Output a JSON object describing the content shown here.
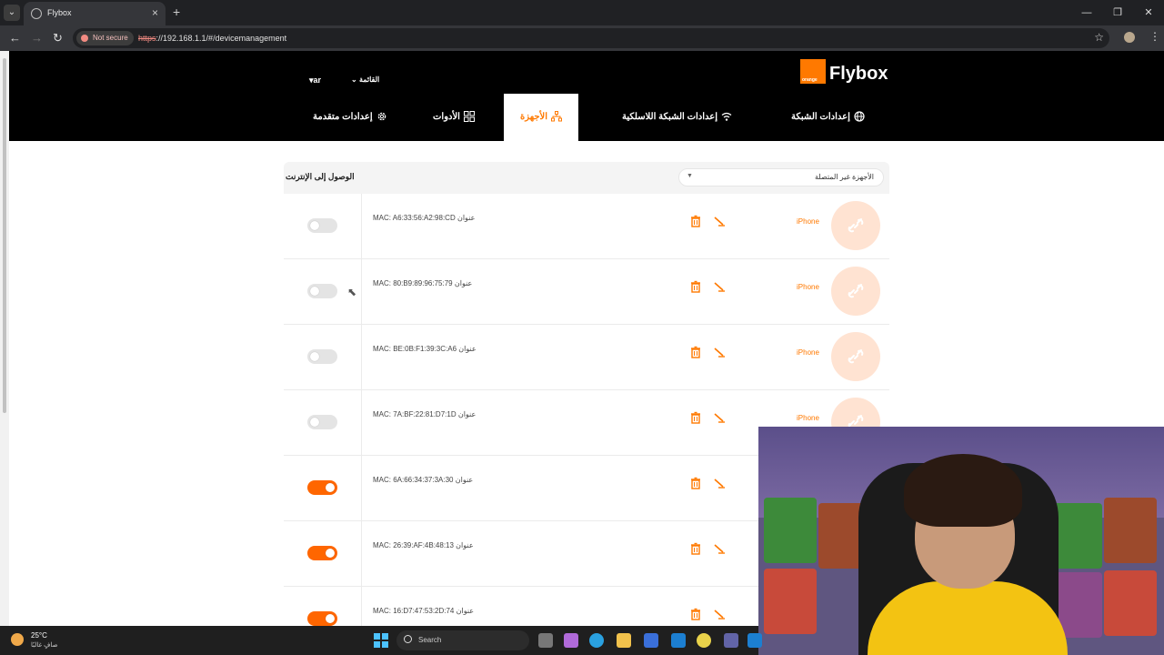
{
  "browser": {
    "tab_title": "Flybox",
    "new_tab": "+",
    "security_label": "Not secure",
    "url_scheme": "https",
    "url_rest": "://192.168.1.1/#/devicemanagement"
  },
  "header": {
    "lang": "ar",
    "menu_label": "القائمة",
    "logo_small": "orange",
    "brand": "Flybox",
    "nav": {
      "network": "إعدادات الشبكة",
      "wireless": "إعدادات الشبكة اللاسلكية",
      "devices": "الأجهزة",
      "tools": "الأدوات",
      "advanced": "إعدادات متقدمة"
    }
  },
  "devices": {
    "filter_value": "الأجهزة غير المتصلة",
    "column_title": "الوصول إلى الإنترنت",
    "address_label": "عنوان",
    "items": [
      {
        "name": "iPhone",
        "mac": "MAC: A6:33:56:A2:98:CD",
        "access": false
      },
      {
        "name": "iPhone",
        "mac": "MAC: 80:B9:89:96:75:79",
        "access": false
      },
      {
        "name": "iPhone",
        "mac": "MAC: BE:0B:F1:39:3C:A6",
        "access": false
      },
      {
        "name": "iPhone",
        "mac": "MAC: 7A:BF:22:81:D7:1D",
        "access": false
      },
      {
        "name": "",
        "mac": "MAC: 6A:66:34:37:3A:30",
        "access": true
      },
      {
        "name": "",
        "mac": "MAC: 26:39:AF:4B:48:13",
        "access": true
      },
      {
        "name": "",
        "mac": "MAC: 16:D7:47:53:2D:74",
        "access": true
      }
    ]
  },
  "taskbar": {
    "temperature": "25°C",
    "condition": "صافٍ غالبًا",
    "search_label": "Search"
  },
  "colors": {
    "accent": "#ff7900",
    "toggle_on": "#ff6600",
    "header_bg": "#000000"
  }
}
